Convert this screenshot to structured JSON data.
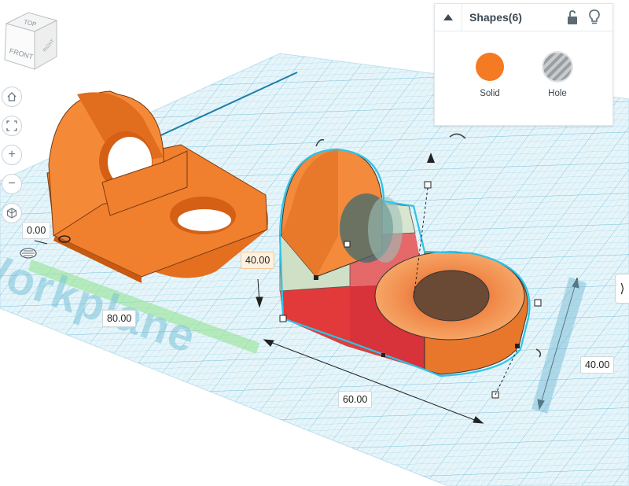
{
  "viewcube": {
    "top": "TOP",
    "front": "FRONT",
    "right": "RIGHT"
  },
  "toolbar": {
    "home_icon": "home-icon",
    "fit_icon": "fit-view-icon",
    "zoom_in_label": "+",
    "zoom_out_label": "−",
    "perspective_icon": "perspective-cube-icon"
  },
  "inspector": {
    "title": "Shapes(6)",
    "solid_label": "Solid",
    "hole_label": "Hole",
    "solid_color": "#f47a24"
  },
  "workplane": {
    "label": "Workplane"
  },
  "dimensions": {
    "origin": "0.00",
    "height": "40.00",
    "length": "80.00",
    "width": "60.00",
    "depth": "40.00"
  },
  "colors": {
    "grid": "#d9eef5",
    "grid_major": "#a9d6e6",
    "selection": "#2ec3e8",
    "part": "#f07f2e",
    "part_dark": "#d9691b",
    "hole_fill": "#c8d6c4",
    "red_box": "#e23a3a"
  },
  "side_tab": {
    "icon": "expand-panel-icon",
    "glyph": "⟩"
  }
}
